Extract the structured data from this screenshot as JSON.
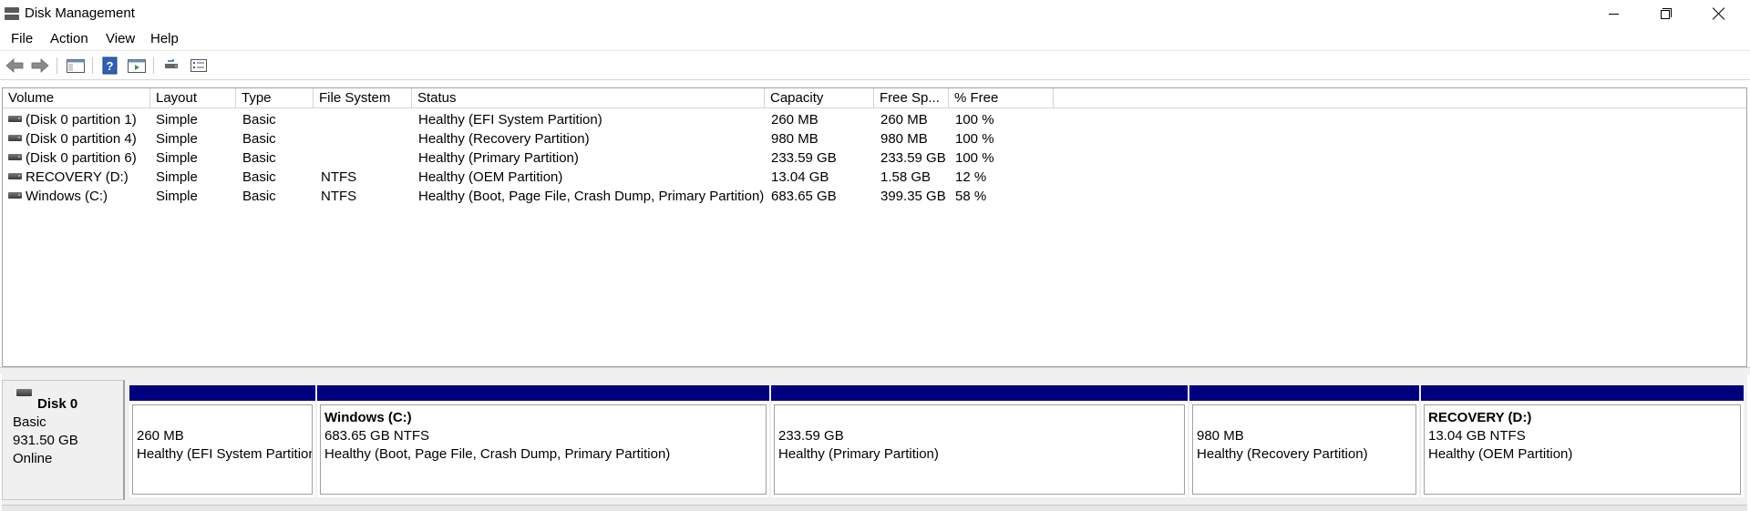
{
  "window": {
    "title": "Disk Management"
  },
  "menu": {
    "file": "File",
    "action": "Action",
    "view": "View",
    "help": "Help"
  },
  "toolbar": {
    "icons": [
      "back-arrow-icon",
      "forward-arrow-icon",
      "console-tree-icon",
      "help-icon",
      "action-pane-icon",
      "rescan-disks-icon",
      "properties-icon"
    ]
  },
  "columns": [
    "Volume",
    "Layout",
    "Type",
    "File System",
    "Status",
    "Capacity",
    "Free Sp...",
    "% Free"
  ],
  "volumes": [
    {
      "volume": "(Disk 0 partition 1)",
      "layout": "Simple",
      "type": "Basic",
      "fs": "",
      "status": "Healthy (EFI System Partition)",
      "capacity": "260 MB",
      "free": "260 MB",
      "pct": "100 %"
    },
    {
      "volume": "(Disk 0 partition 4)",
      "layout": "Simple",
      "type": "Basic",
      "fs": "",
      "status": "Healthy (Recovery Partition)",
      "capacity": "980 MB",
      "free": "980 MB",
      "pct": "100 %"
    },
    {
      "volume": "(Disk 0 partition 6)",
      "layout": "Simple",
      "type": "Basic",
      "fs": "",
      "status": "Healthy (Primary Partition)",
      "capacity": "233.59 GB",
      "free": "233.59 GB",
      "pct": "100 %"
    },
    {
      "volume": "RECOVERY (D:)",
      "layout": "Simple",
      "type": "Basic",
      "fs": "NTFS",
      "status": "Healthy (OEM Partition)",
      "capacity": "13.04 GB",
      "free": "1.58 GB",
      "pct": "12 %"
    },
    {
      "volume": "Windows (C:)",
      "layout": "Simple",
      "type": "Basic",
      "fs": "NTFS",
      "status": "Healthy (Boot, Page File, Crash Dump, Primary Partition)",
      "capacity": "683.65 GB",
      "free": "399.35 GB",
      "pct": "58 %"
    }
  ],
  "disk": {
    "name": "Disk 0",
    "type": "Basic",
    "size": "931.50 GB",
    "status": "Online"
  },
  "partitions": [
    {
      "title": "",
      "line2": "260 MB",
      "line3": "Healthy (EFI System Partition)"
    },
    {
      "title": "Windows  (C:)",
      "line2": "683.65 GB NTFS",
      "line3": "Healthy (Boot, Page File, Crash Dump, Primary Partition)"
    },
    {
      "title": "",
      "line2": "233.59 GB",
      "line3": "Healthy (Primary Partition)"
    },
    {
      "title": "",
      "line2": "980 MB",
      "line3": "Healthy (Recovery Partition)"
    },
    {
      "title": "RECOVERY  (D:)",
      "line2": "13.04 GB NTFS",
      "line3": "Healthy (OEM Partition)"
    }
  ],
  "colors": {
    "partition_bar": "#00007f",
    "accent_green": "#6bd16b"
  }
}
